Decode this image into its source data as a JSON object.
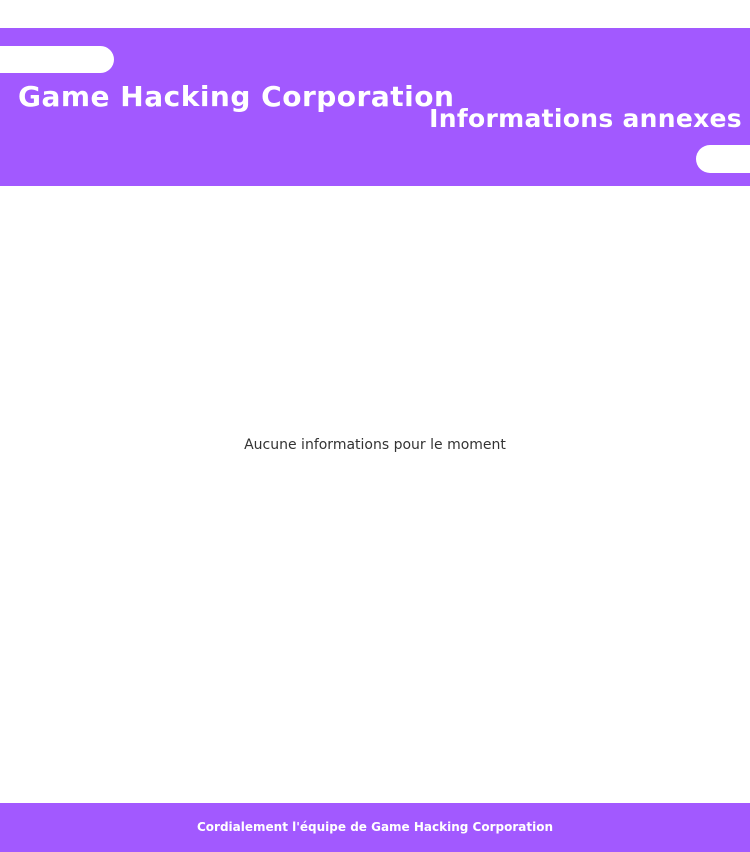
{
  "colors": {
    "accent": "#a259ff",
    "background": "#ffffff",
    "text": "#333333"
  },
  "header": {
    "site_title": "Game Hacking Corporation",
    "section_title": "Informations annexes"
  },
  "main": {
    "empty_message": "Aucune informations pour le moment"
  },
  "footer": {
    "signature": "Cordialement l'équipe de Game Hacking Corporation"
  }
}
